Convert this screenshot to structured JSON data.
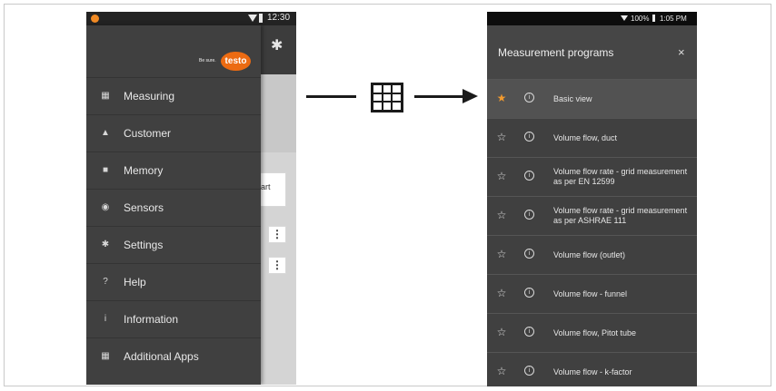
{
  "left_phone": {
    "status": {
      "time": "12:30"
    },
    "brand": {
      "tagline": "Be sure.",
      "logo": "testo"
    },
    "background": {
      "card_text": "art"
    },
    "menu": [
      {
        "icon": "grid-icon",
        "glyph": "▦",
        "label": "Measuring"
      },
      {
        "icon": "person-icon",
        "glyph": "▲",
        "label": "Customer"
      },
      {
        "icon": "save-icon",
        "glyph": "■",
        "label": "Memory"
      },
      {
        "icon": "sensor-icon",
        "glyph": "◉",
        "label": "Sensors"
      },
      {
        "icon": "gear-icon",
        "glyph": "✱",
        "label": "Settings"
      },
      {
        "icon": "help-icon",
        "glyph": "?",
        "label": "Help"
      },
      {
        "icon": "info-icon",
        "glyph": "i",
        "label": "Information"
      },
      {
        "icon": "apps-icon",
        "glyph": "▦",
        "label": "Additional Apps"
      }
    ]
  },
  "right_phone": {
    "status": {
      "battery": "100%",
      "time": "1:05 PM"
    },
    "title": "Measurement programs",
    "close_glyph": "×",
    "programs": [
      {
        "label": "Basic view",
        "favorite": true
      },
      {
        "label": "Volume flow, duct",
        "favorite": false
      },
      {
        "label": "Volume flow rate - grid measurement as per EN 12599",
        "favorite": false
      },
      {
        "label": "Volume flow rate - grid measurement as per ASHRAE 111",
        "favorite": false
      },
      {
        "label": "Volume flow (outlet)",
        "favorite": false
      },
      {
        "label": "Volume flow - funnel",
        "favorite": false
      },
      {
        "label": "Volume flow, Pitot tube",
        "favorite": false
      },
      {
        "label": "Volume flow - k-factor",
        "favorite": false
      }
    ]
  },
  "colors": {
    "accent": "#ec6b12",
    "favorite_star": "#f29a2e",
    "drawer_bg": "#404040"
  }
}
